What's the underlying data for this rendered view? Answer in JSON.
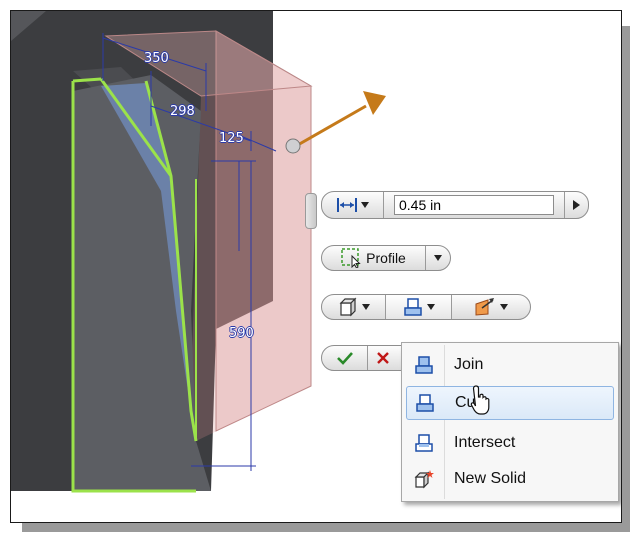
{
  "dimensions": [
    "350",
    "298",
    "125",
    "590"
  ],
  "distance_control": {
    "value": "0.45 in"
  },
  "profile_button": {
    "label": "Profile"
  },
  "output_menu": {
    "items": [
      {
        "label": "Join",
        "icon": "join-icon",
        "highlighted": false
      },
      {
        "label": "Cut",
        "icon": "cut-icon",
        "highlighted": true
      },
      {
        "label": "Intersect",
        "icon": "intersect-icon",
        "highlighted": false
      },
      {
        "label": "New Solid",
        "icon": "new-solid-icon",
        "highlighted": false
      }
    ]
  },
  "colors": {
    "sketch_green": "#9be24a",
    "dimension_blue": "#2b3aa8",
    "menu_highlight": "#dbe9f8",
    "extent_arrow": "#c57a1a"
  }
}
